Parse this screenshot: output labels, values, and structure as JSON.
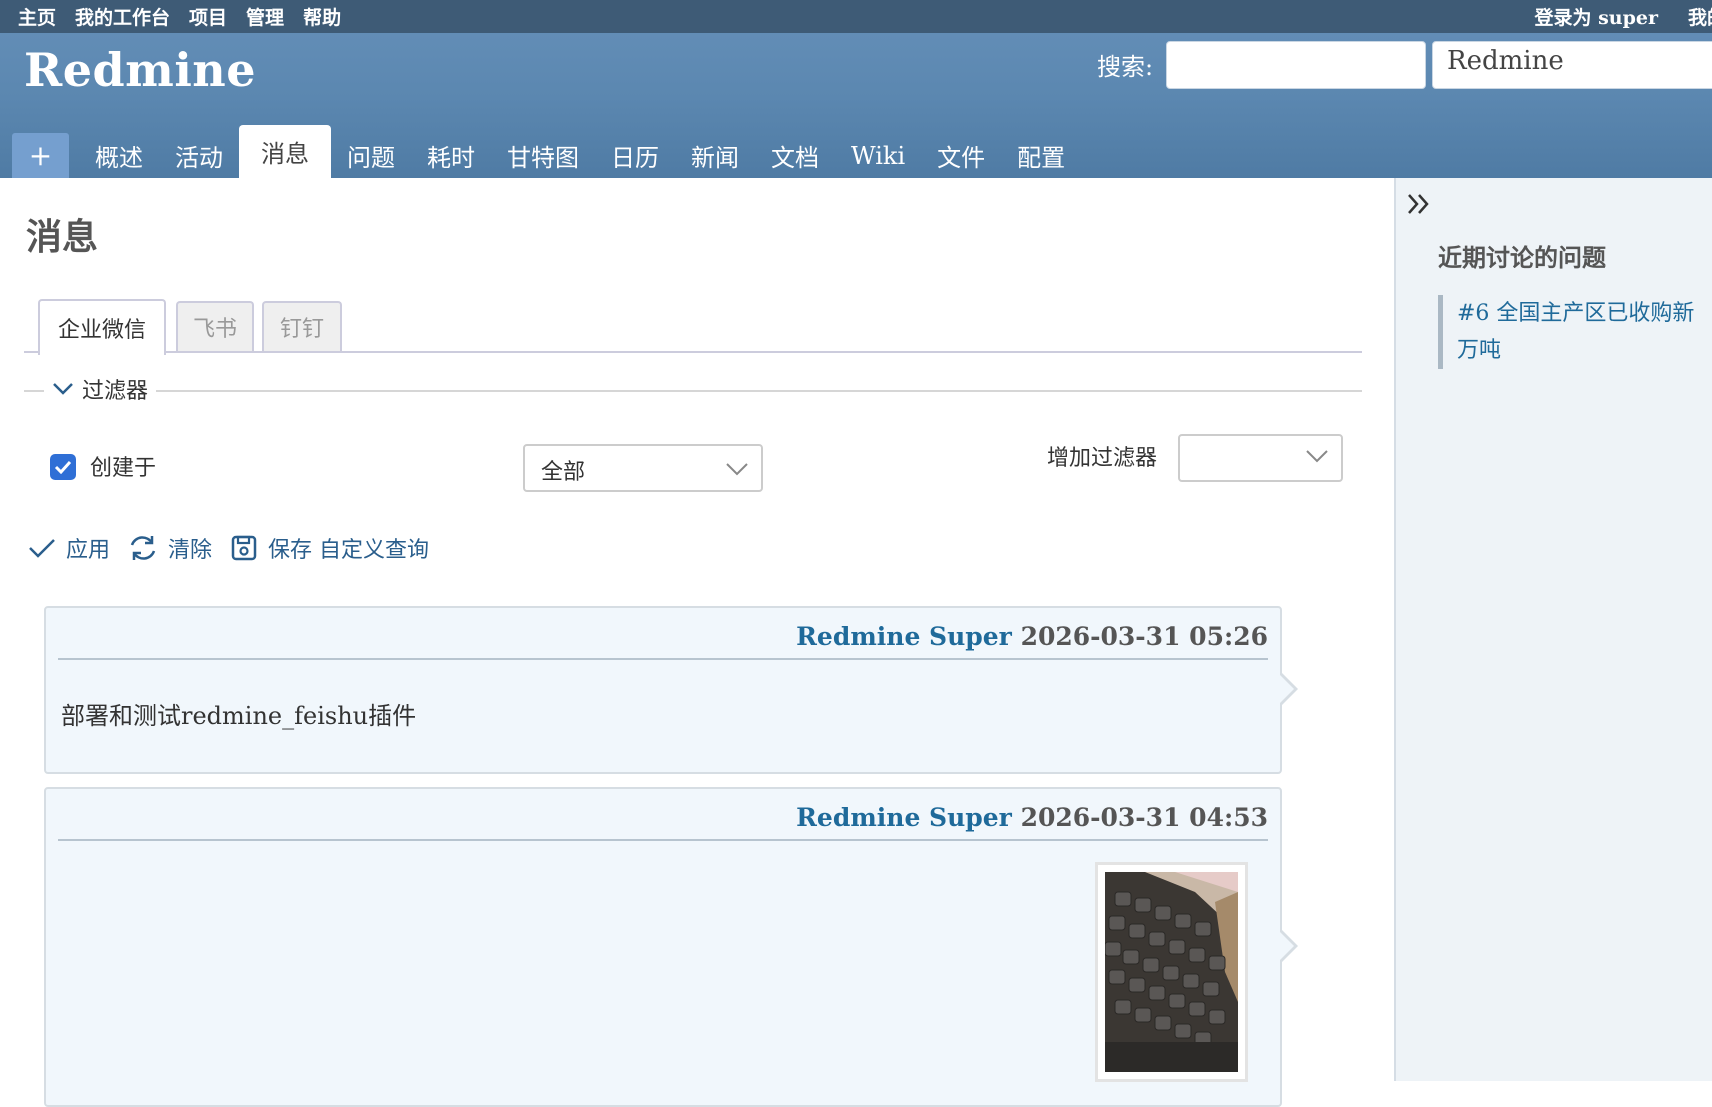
{
  "top_menu": {
    "left": [
      "主页",
      "我的工作台",
      "项目",
      "管理",
      "帮助"
    ],
    "logged_in_label": "登录为",
    "logged_in_user": "super",
    "my_account": "我的"
  },
  "header": {
    "logo": "Redmine",
    "search_label": "搜索:",
    "search_value": "",
    "project_jump": "Redmine"
  },
  "main_menu": {
    "new_label": "+",
    "items": [
      "概述",
      "活动",
      "消息",
      "问题",
      "耗时",
      "甘特图",
      "日历",
      "新闻",
      "文档",
      "Wiki",
      "文件",
      "配置"
    ],
    "selected_index": 2
  },
  "page": {
    "title": "消息",
    "tabs": [
      "企业微信",
      "飞书",
      "钉钉"
    ],
    "active_tab_index": 0
  },
  "filters": {
    "legend": "过滤器",
    "created_label": "创建于",
    "created_checked": true,
    "operator": "全部",
    "add_filter_label": "增加过滤器",
    "add_filter_value": ""
  },
  "actions": {
    "apply": "应用",
    "clear": "清除",
    "save": "保存 自定义查询"
  },
  "messages": [
    {
      "author": "Redmine Super",
      "datetime": "2026-03-31 05:26",
      "text": "部署和测试redmine_feishu插件"
    },
    {
      "author": "Redmine Super",
      "datetime": "2026-03-31 04:53",
      "text": ""
    }
  ],
  "sidebar": {
    "title": "近期讨论的问题",
    "issues": [
      "#6 全国主产区已收购新",
      "万吨"
    ]
  },
  "colors": {
    "top_bar": "#3e5b76",
    "header": "#628db6",
    "link": "#1f6a9a",
    "journal_bg": "#f1f7fc"
  }
}
